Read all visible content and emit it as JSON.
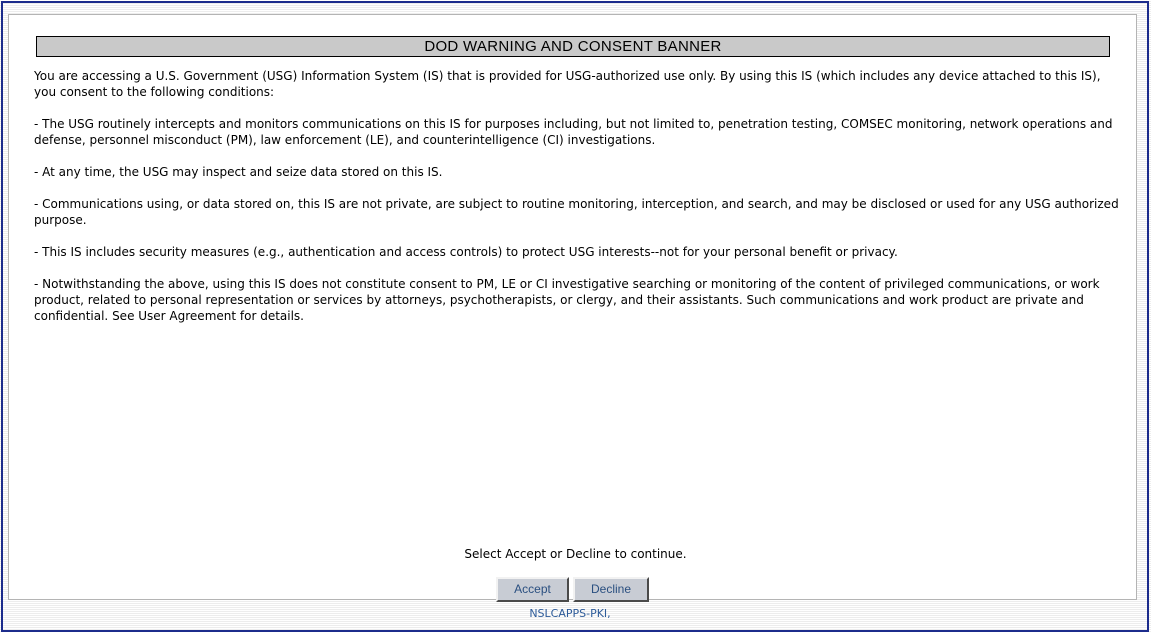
{
  "banner": {
    "title": "DOD WARNING AND CONSENT BANNER",
    "paragraphs": [
      "You are accessing a U.S. Government (USG) Information System (IS) that is provided for USG-authorized use only. By using this IS (which includes any device attached to this IS), you consent to the following conditions:",
      "- The USG routinely intercepts and monitors communications on this IS for purposes including, but not limited to, penetration testing, COMSEC monitoring, network operations and defense, personnel misconduct (PM), law enforcement (LE), and counterintelligence (CI) investigations.",
      "- At any time, the USG may inspect and seize data stored on this IS.",
      "- Communications using, or data stored on, this IS are not private, are subject to routine monitoring, interception, and search, and may be disclosed or used for any USG authorized purpose.",
      "- This IS includes security measures (e.g., authentication and access controls) to protect USG interests--not for your personal benefit or privacy.",
      "- Notwithstanding the above, using this IS does not constitute consent to PM, LE or CI investigative searching or monitoring of the content of privileged communications, or work product, related to personal representation or services by attorneys, psychotherapists, or clergy, and their assistants. Such communications and work product are private and confidential. See User Agreement for details."
    ],
    "prompt": "Select Accept or Decline to continue."
  },
  "buttons": {
    "accept_label": "Accept",
    "decline_label": "Decline"
  },
  "footer": {
    "text": "NSLCAPPS-PKI,"
  },
  "colors": {
    "frame_border": "#1c2c8c",
    "title_background": "#c9c9c9",
    "button_background": "#c8ccd4",
    "button_text": "#2a4f80",
    "footer_text": "#2d5b99"
  }
}
